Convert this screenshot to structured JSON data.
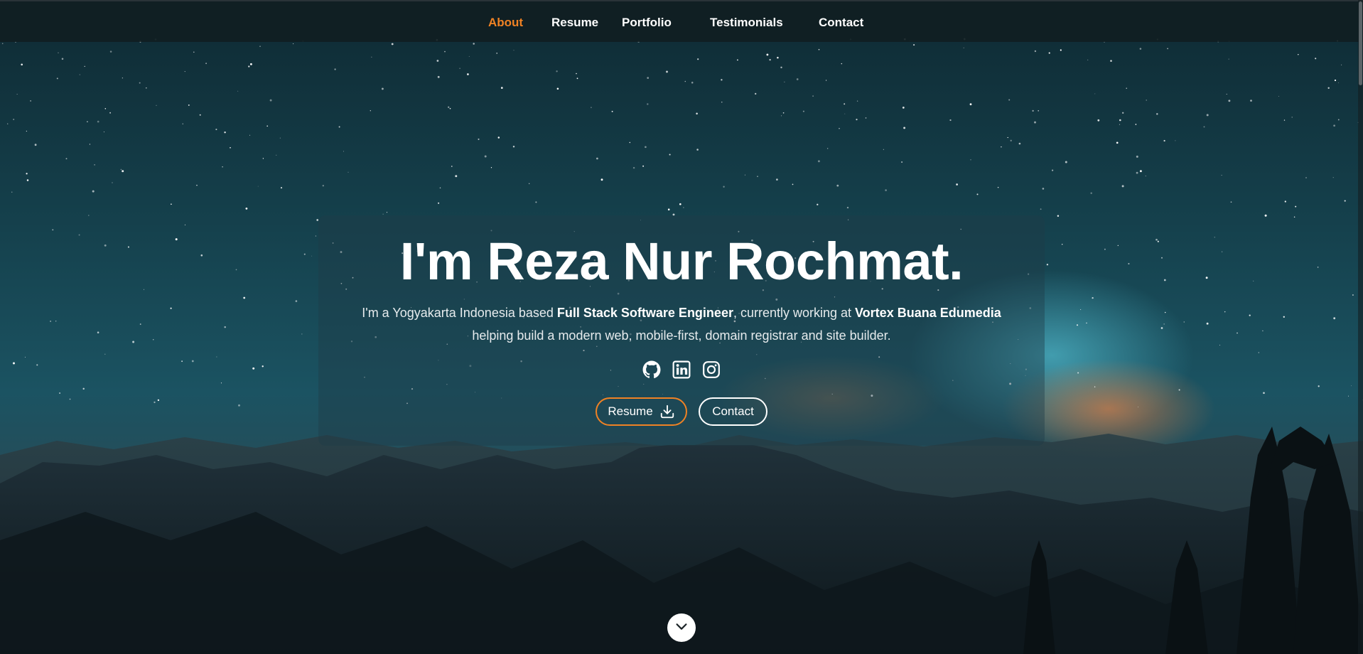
{
  "nav": {
    "items": [
      {
        "label": "About",
        "active": true
      },
      {
        "label": "Resume",
        "active": false
      },
      {
        "label": "Portfolio",
        "active": false
      },
      {
        "label": "Testimonials",
        "active": false
      },
      {
        "label": "Contact",
        "active": false
      }
    ]
  },
  "hero": {
    "title": "I'm Reza Nur Rochmat.",
    "intro_1": "I'm a Yogyakarta Indonesia based ",
    "role": "Full Stack Software Engineer",
    "intro_2": ", currently working at ",
    "company": "Vortex Buana Edumedia",
    "intro_3": "helping build a modern web, mobile-first, domain registrar and site builder.",
    "social_icons": [
      "github-icon",
      "linkedin-icon",
      "instagram-icon"
    ],
    "resume_button": "Resume",
    "contact_button": "Contact"
  },
  "colors": {
    "accent": "#f08224",
    "navbar": "#101e22",
    "text": "#ffffff"
  },
  "icons": {
    "resume_button_icon": "download-icon",
    "scroll_button_icon": "chevron-down-icon"
  }
}
